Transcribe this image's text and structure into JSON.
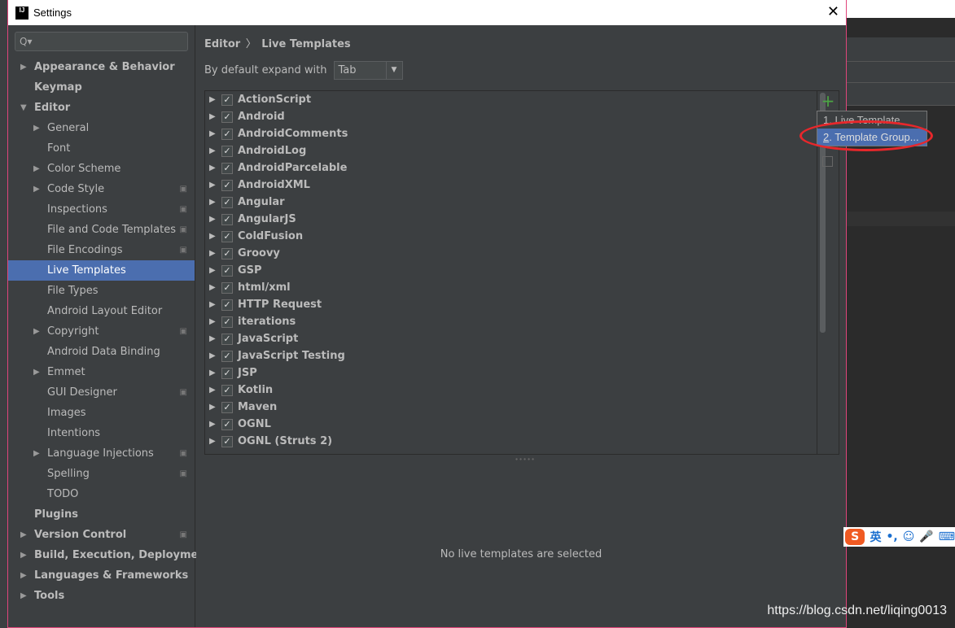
{
  "window": {
    "title": "Settings",
    "logo": "IJ",
    "close_icon": "close-icon"
  },
  "sidebar": {
    "search_placeholder": "Q▾",
    "items": [
      {
        "label": "Appearance & Behavior",
        "level": 0,
        "arrow": "▶",
        "bold": true
      },
      {
        "label": "Keymap",
        "level": 0,
        "arrow": "",
        "bold": true
      },
      {
        "label": "Editor",
        "level": 0,
        "arrow": "▼",
        "bold": true
      },
      {
        "label": "General",
        "level": 1,
        "arrow": "▶"
      },
      {
        "label": "Font",
        "level": 1,
        "arrow": ""
      },
      {
        "label": "Color Scheme",
        "level": 1,
        "arrow": "▶"
      },
      {
        "label": "Code Style",
        "level": 1,
        "arrow": "▶",
        "cfg": true
      },
      {
        "label": "Inspections",
        "level": 1,
        "arrow": "",
        "cfg": true
      },
      {
        "label": "File and Code Templates",
        "level": 1,
        "arrow": "",
        "cfg": true
      },
      {
        "label": "File Encodings",
        "level": 1,
        "arrow": "",
        "cfg": true
      },
      {
        "label": "Live Templates",
        "level": 1,
        "arrow": "",
        "selected": true
      },
      {
        "label": "File Types",
        "level": 1,
        "arrow": ""
      },
      {
        "label": "Android Layout Editor",
        "level": 1,
        "arrow": ""
      },
      {
        "label": "Copyright",
        "level": 1,
        "arrow": "▶",
        "cfg": true
      },
      {
        "label": "Android Data Binding",
        "level": 1,
        "arrow": ""
      },
      {
        "label": "Emmet",
        "level": 1,
        "arrow": "▶"
      },
      {
        "label": "GUI Designer",
        "level": 1,
        "arrow": "",
        "cfg": true
      },
      {
        "label": "Images",
        "level": 1,
        "arrow": ""
      },
      {
        "label": "Intentions",
        "level": 1,
        "arrow": ""
      },
      {
        "label": "Language Injections",
        "level": 1,
        "arrow": "▶",
        "cfg": true
      },
      {
        "label": "Spelling",
        "level": 1,
        "arrow": "",
        "cfg": true
      },
      {
        "label": "TODO",
        "level": 1,
        "arrow": ""
      },
      {
        "label": "Plugins",
        "level": 0,
        "arrow": "",
        "bold": true
      },
      {
        "label": "Version Control",
        "level": 0,
        "arrow": "▶",
        "bold": true,
        "cfg": true
      },
      {
        "label": "Build, Execution, Deployment",
        "level": 0,
        "arrow": "▶",
        "bold": true
      },
      {
        "label": "Languages & Frameworks",
        "level": 0,
        "arrow": "▶",
        "bold": true
      },
      {
        "label": "Tools",
        "level": 0,
        "arrow": "▶",
        "bold": true
      }
    ]
  },
  "main": {
    "breadcrumb": [
      "Editor",
      "〉",
      "Live Templates"
    ],
    "expand_label": "By default expand with",
    "expand_value": "Tab",
    "groups": [
      "ActionScript",
      "Android",
      "AndroidComments",
      "AndroidLog",
      "AndroidParcelable",
      "AndroidXML",
      "Angular",
      "AngularJS",
      "ColdFusion",
      "Groovy",
      "GSP",
      "html/xml",
      "HTTP Request",
      "iterations",
      "JavaScript",
      "JavaScript Testing",
      "JSP",
      "Kotlin",
      "Maven",
      "OGNL",
      "OGNL (Struts 2)"
    ],
    "add_label": "+",
    "empty_text": "No live templates are selected"
  },
  "popup": {
    "items": [
      {
        "num": "1",
        "label": ". Live Template"
      },
      {
        "num": "2",
        "label": ". Template Group..."
      }
    ]
  },
  "ime": {
    "logo": "S",
    "items": [
      "英",
      "•,",
      "☺",
      "🎤",
      "⌨"
    ]
  },
  "watermark": "https://blog.csdn.net/liqing0013",
  "colors": {
    "selection": "#4b6eaf",
    "annotation": "#e8272b",
    "add": "#4ca744"
  }
}
